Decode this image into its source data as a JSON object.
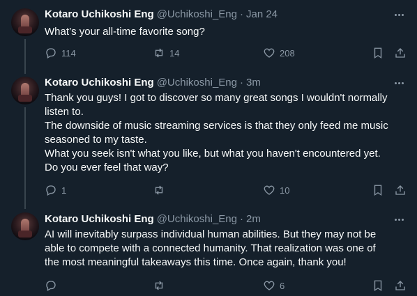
{
  "tweets": [
    {
      "name": "Kotaro Uchikoshi Eng",
      "handle": "@Uchikoshi_Eng",
      "separator": "·",
      "time": "Jan 24",
      "lines": [
        "What’s your all-time favorite song?"
      ],
      "replies": "114",
      "retweets": "14",
      "likes": "208"
    },
    {
      "name": "Kotaro Uchikoshi Eng",
      "handle": "@Uchikoshi_Eng",
      "separator": "·",
      "time": "3m",
      "lines": [
        "Thank you guys! I got to discover so many great songs I wouldn't normally",
        "listen to.",
        "The downside of music streaming services is that they only feed me music",
        "seasoned to my taste.",
        "What you seek isn't what you like, but what you haven't encountered yet.",
        "Do you ever feel that way?"
      ],
      "replies": "1",
      "retweets": "",
      "likes": "10"
    },
    {
      "name": "Kotaro Uchikoshi Eng",
      "handle": "@Uchikoshi_Eng",
      "separator": "·",
      "time": "2m",
      "lines": [
        "AI will inevitably surpass individual human abilities. But they may not be",
        "able to compete with a connected humanity. That realization was one of",
        "the most meaningful takeaways this time. Once again, thank you!"
      ],
      "replies": "",
      "retweets": "",
      "likes": "6"
    }
  ],
  "icons": {
    "reply": "reply-icon",
    "retweet": "retweet-icon",
    "like": "heart-icon",
    "bookmark": "bookmark-icon",
    "share": "share-icon",
    "more": "more-icon"
  },
  "colors": {
    "background": "#15202b",
    "text": "#f7f9f9",
    "secondary": "#8b98a5",
    "thread_line": "#38444d"
  }
}
